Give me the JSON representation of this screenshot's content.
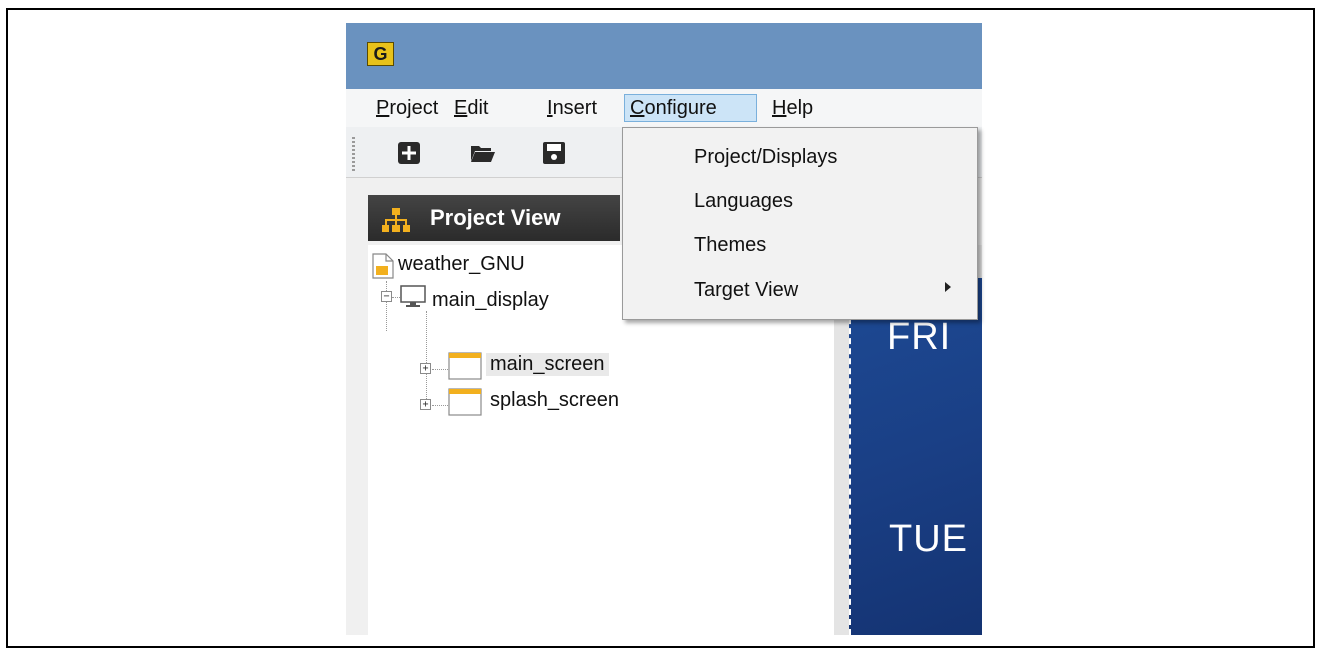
{
  "window": {
    "logo_text": "G"
  },
  "menubar": {
    "items": [
      {
        "label": "Project",
        "accel": "P",
        "rest": "roject"
      },
      {
        "label": "Edit",
        "accel": "E",
        "rest": "dit"
      },
      {
        "label": "Insert",
        "accel": "I",
        "rest": "nsert"
      },
      {
        "label": "Configure",
        "accel": "C",
        "rest": "onfigure"
      },
      {
        "label": "Help",
        "accel": "H",
        "rest": "elp"
      }
    ],
    "active": "Configure"
  },
  "toolbar": {
    "icons": [
      "add-icon",
      "open-folder-icon",
      "save-icon"
    ]
  },
  "project_view": {
    "title": "Project View",
    "tree": {
      "project": "weather_GNU",
      "display": "main_display",
      "screens": [
        "main_screen",
        "splash_screen"
      ]
    }
  },
  "configure_menu": {
    "items": [
      "Project/Displays",
      "Languages",
      "Themes",
      "Target View"
    ]
  },
  "preview": {
    "days": [
      "FRI",
      "TUE"
    ]
  },
  "colors": {
    "titlebar": "#6a92bf",
    "menu_highlight": "#cce4f7",
    "preview_bg": "#1a3f85"
  }
}
